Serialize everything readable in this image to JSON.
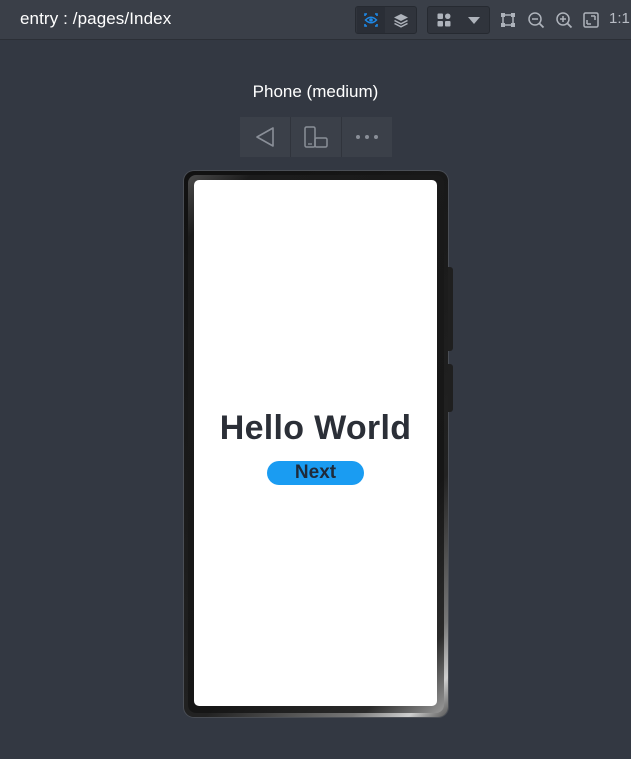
{
  "toolbar": {
    "route_title": "entry : /pages/Index",
    "zoom_ratio_label": "1:1",
    "icons": [
      "eye-icon",
      "layers-icon",
      "grid-icon",
      "dropdown-arrow-icon",
      "crop-frame-icon",
      "zoom-out-icon",
      "zoom-in-icon",
      "fit-screen-icon"
    ],
    "accent_color": "#1e88e5"
  },
  "preview": {
    "device_name": "Phone (medium)",
    "controls": [
      "back-triangle-icon",
      "rotate-device-icon",
      "more-icon"
    ]
  },
  "app_screen": {
    "heading": "Hello World",
    "button_label": "Next",
    "button_color": "#1a9cf2"
  }
}
